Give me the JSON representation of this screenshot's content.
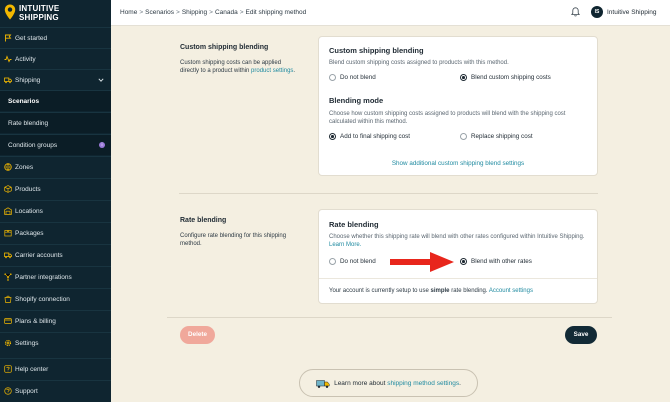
{
  "app": {
    "logo_line1": "INTUITIVE",
    "logo_line2": "SHIPPING"
  },
  "sidebar": {
    "items": [
      {
        "label": "Get started",
        "icon": "flag-icon"
      },
      {
        "label": "Activity",
        "icon": "activity-icon"
      },
      {
        "label": "Shipping",
        "icon": "truck-icon"
      },
      {
        "label": "Scenarios"
      },
      {
        "label": "Rate blending"
      },
      {
        "label": "Condition groups",
        "badge": "i"
      },
      {
        "label": "Zones",
        "icon": "globe-icon"
      },
      {
        "label": "Products",
        "icon": "box-icon"
      },
      {
        "label": "Locations",
        "icon": "warehouse-icon"
      },
      {
        "label": "Packages",
        "icon": "package-icon"
      },
      {
        "label": "Carrier accounts",
        "icon": "truck-icon"
      },
      {
        "label": "Partner integrations",
        "icon": "network-icon"
      },
      {
        "label": "Shopify connection",
        "icon": "shopping-bag-icon"
      },
      {
        "label": "Plans & billing",
        "icon": "card-icon"
      },
      {
        "label": "Settings",
        "icon": "gear-icon"
      },
      {
        "label": "Help center",
        "icon": "help-icon"
      },
      {
        "label": "Support",
        "icon": "support-icon"
      }
    ]
  },
  "header": {
    "breadcrumb": [
      "Home",
      "Scenarios",
      "Shipping",
      "Canada",
      "Edit shipping method"
    ],
    "separator": ">",
    "user_initials": "IS",
    "user_name": "Intuitive Shipping"
  },
  "custom_blending": {
    "side_title": "Custom shipping blending",
    "side_desc": "Custom shipping costs can be applied directly to a product within",
    "side_link": "product settings",
    "side_period": ".",
    "card_title": "Custom shipping blending",
    "card_desc": "Blend custom shipping costs assigned to products with this method.",
    "opt_no": "Do not blend",
    "opt_yes": "Blend custom shipping costs",
    "mode_title": "Blending mode",
    "mode_desc": "Choose how custom shipping costs assigned to products will blend with the shipping cost calculated within this method.",
    "mode_add": "Add to final shipping cost",
    "mode_replace": "Replace shipping cost",
    "show_more": "Show additional custom shipping blend settings"
  },
  "rate_blending": {
    "side_title": "Rate blending",
    "side_desc": "Configure rate blending for this shipping method.",
    "card_title": "Rate blending",
    "card_desc": "Choose whether this shipping rate will blend with other rates configured within Intuitive Shipping.",
    "learn_more": "Learn More.",
    "opt_no": "Do not blend",
    "opt_yes": "Blend with other rates",
    "account_pre": "Your account is currently setup to use",
    "account_mode": "simple",
    "account_post": "rate blending.",
    "account_link": "Account settings"
  },
  "actions": {
    "delete": "Delete",
    "save": "Save"
  },
  "footer": {
    "learn_pre": "Learn more about",
    "learn_link": "shipping method settings",
    "learn_post": "."
  },
  "colors": {
    "sidebar_bg": "#0f2530",
    "page_bg": "#f4efe1",
    "accent_link": "#1f8aa0",
    "save_bg": "#122a36",
    "delete_bg": "#f0a89b",
    "arrow": "#e8261c"
  }
}
